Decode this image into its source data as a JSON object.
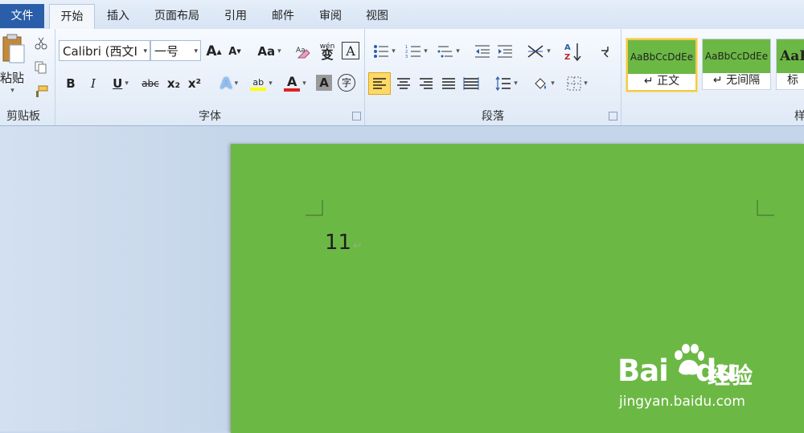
{
  "tabs": {
    "file": "文件",
    "items": [
      "开始",
      "插入",
      "页面布局",
      "引用",
      "邮件",
      "审阅",
      "视图"
    ],
    "active": "开始"
  },
  "clipboard": {
    "paste_label": "粘贴",
    "group_label": "剪贴板"
  },
  "font": {
    "family": "Calibri (西文I",
    "size": "一号",
    "group_label": "字体",
    "grow_label": "A",
    "shrink_label": "A",
    "case_label": "Aa",
    "bold": "B",
    "italic": "I",
    "underline": "U",
    "strike": "abc",
    "sub": "x₂",
    "sup": "x²",
    "phonetic_label": "wén",
    "enclose_label": "字"
  },
  "paragraph": {
    "group_label": "段落"
  },
  "styles": {
    "group_label": "样式",
    "cards": [
      {
        "sample": "AaBbCcDdEe",
        "name": "↵ 正文",
        "selected": true
      },
      {
        "sample": "AaBbCcDdEe",
        "name": "↵ 无间隔",
        "selected": false
      },
      {
        "sample": "AaB",
        "name": "标",
        "selected": false
      }
    ]
  },
  "document": {
    "text": "11",
    "page_color": "#6cb845"
  },
  "watermark": {
    "brand": "Bai",
    "brand_suffix": "du",
    "cn": "经验",
    "url": "jingyan.baidu.com"
  },
  "colors": {
    "highlight": "#ffff00",
    "font_color": "#e02020",
    "accent": "#2a5ea8"
  }
}
